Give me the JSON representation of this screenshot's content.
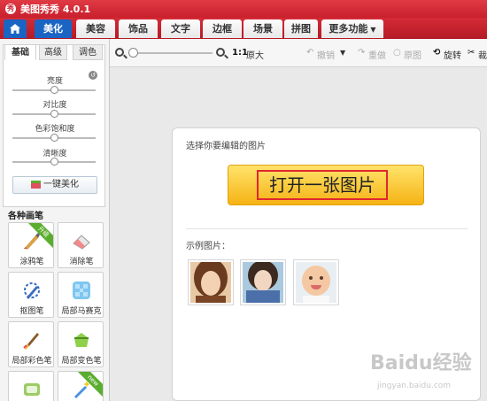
{
  "app": {
    "title": "美图秀秀 4.0.1",
    "logo_text": "秀"
  },
  "nav": {
    "tabs": [
      {
        "label": "美化",
        "active": true
      },
      {
        "label": "美容"
      },
      {
        "label": "饰品"
      },
      {
        "label": "文字"
      },
      {
        "label": "边框"
      },
      {
        "label": "场景"
      },
      {
        "label": "拼图"
      },
      {
        "label": "更多功能"
      }
    ]
  },
  "adjust": {
    "tabs": [
      "基础",
      "高级",
      "调色"
    ],
    "sliders": [
      {
        "label": "亮度",
        "value": 0.5
      },
      {
        "label": "对比度",
        "value": 0.5
      },
      {
        "label": "色彩饱和度",
        "value": 0.5
      },
      {
        "label": "清晰度",
        "value": 0.5
      }
    ],
    "one_click_label": "一键美化"
  },
  "brushes": {
    "title": "各种画笔",
    "items": [
      {
        "label": "涂鸦笔",
        "badge": "升级"
      },
      {
        "label": "消除笔"
      },
      {
        "label": "抠图笔"
      },
      {
        "label": "局部马赛克"
      },
      {
        "label": "局部彩色笔"
      },
      {
        "label": "局部变色笔"
      },
      {
        "label": ""
      },
      {
        "label": "",
        "badge": "new"
      }
    ]
  },
  "toolbar": {
    "zoom_value": 0.0,
    "ratio_label": "1:1",
    "original_size_label": "原大",
    "undo_label": "撤销",
    "redo_label": "重做",
    "original_label": "原图",
    "rotate_label": "旋转",
    "crop_label": "裁"
  },
  "main": {
    "prompt": "选择你要编辑的图片",
    "open_button_label": "打开一张图片",
    "samples_label": "示例图片："
  },
  "watermark": {
    "text": "Baidu经验",
    "sub": "jingyan.baidu.com"
  },
  "colors": {
    "title_red": "#d02030",
    "nav_blue": "#1a64c4",
    "button_yellow": "#f5b315",
    "highlight_red": "#e0262e"
  }
}
